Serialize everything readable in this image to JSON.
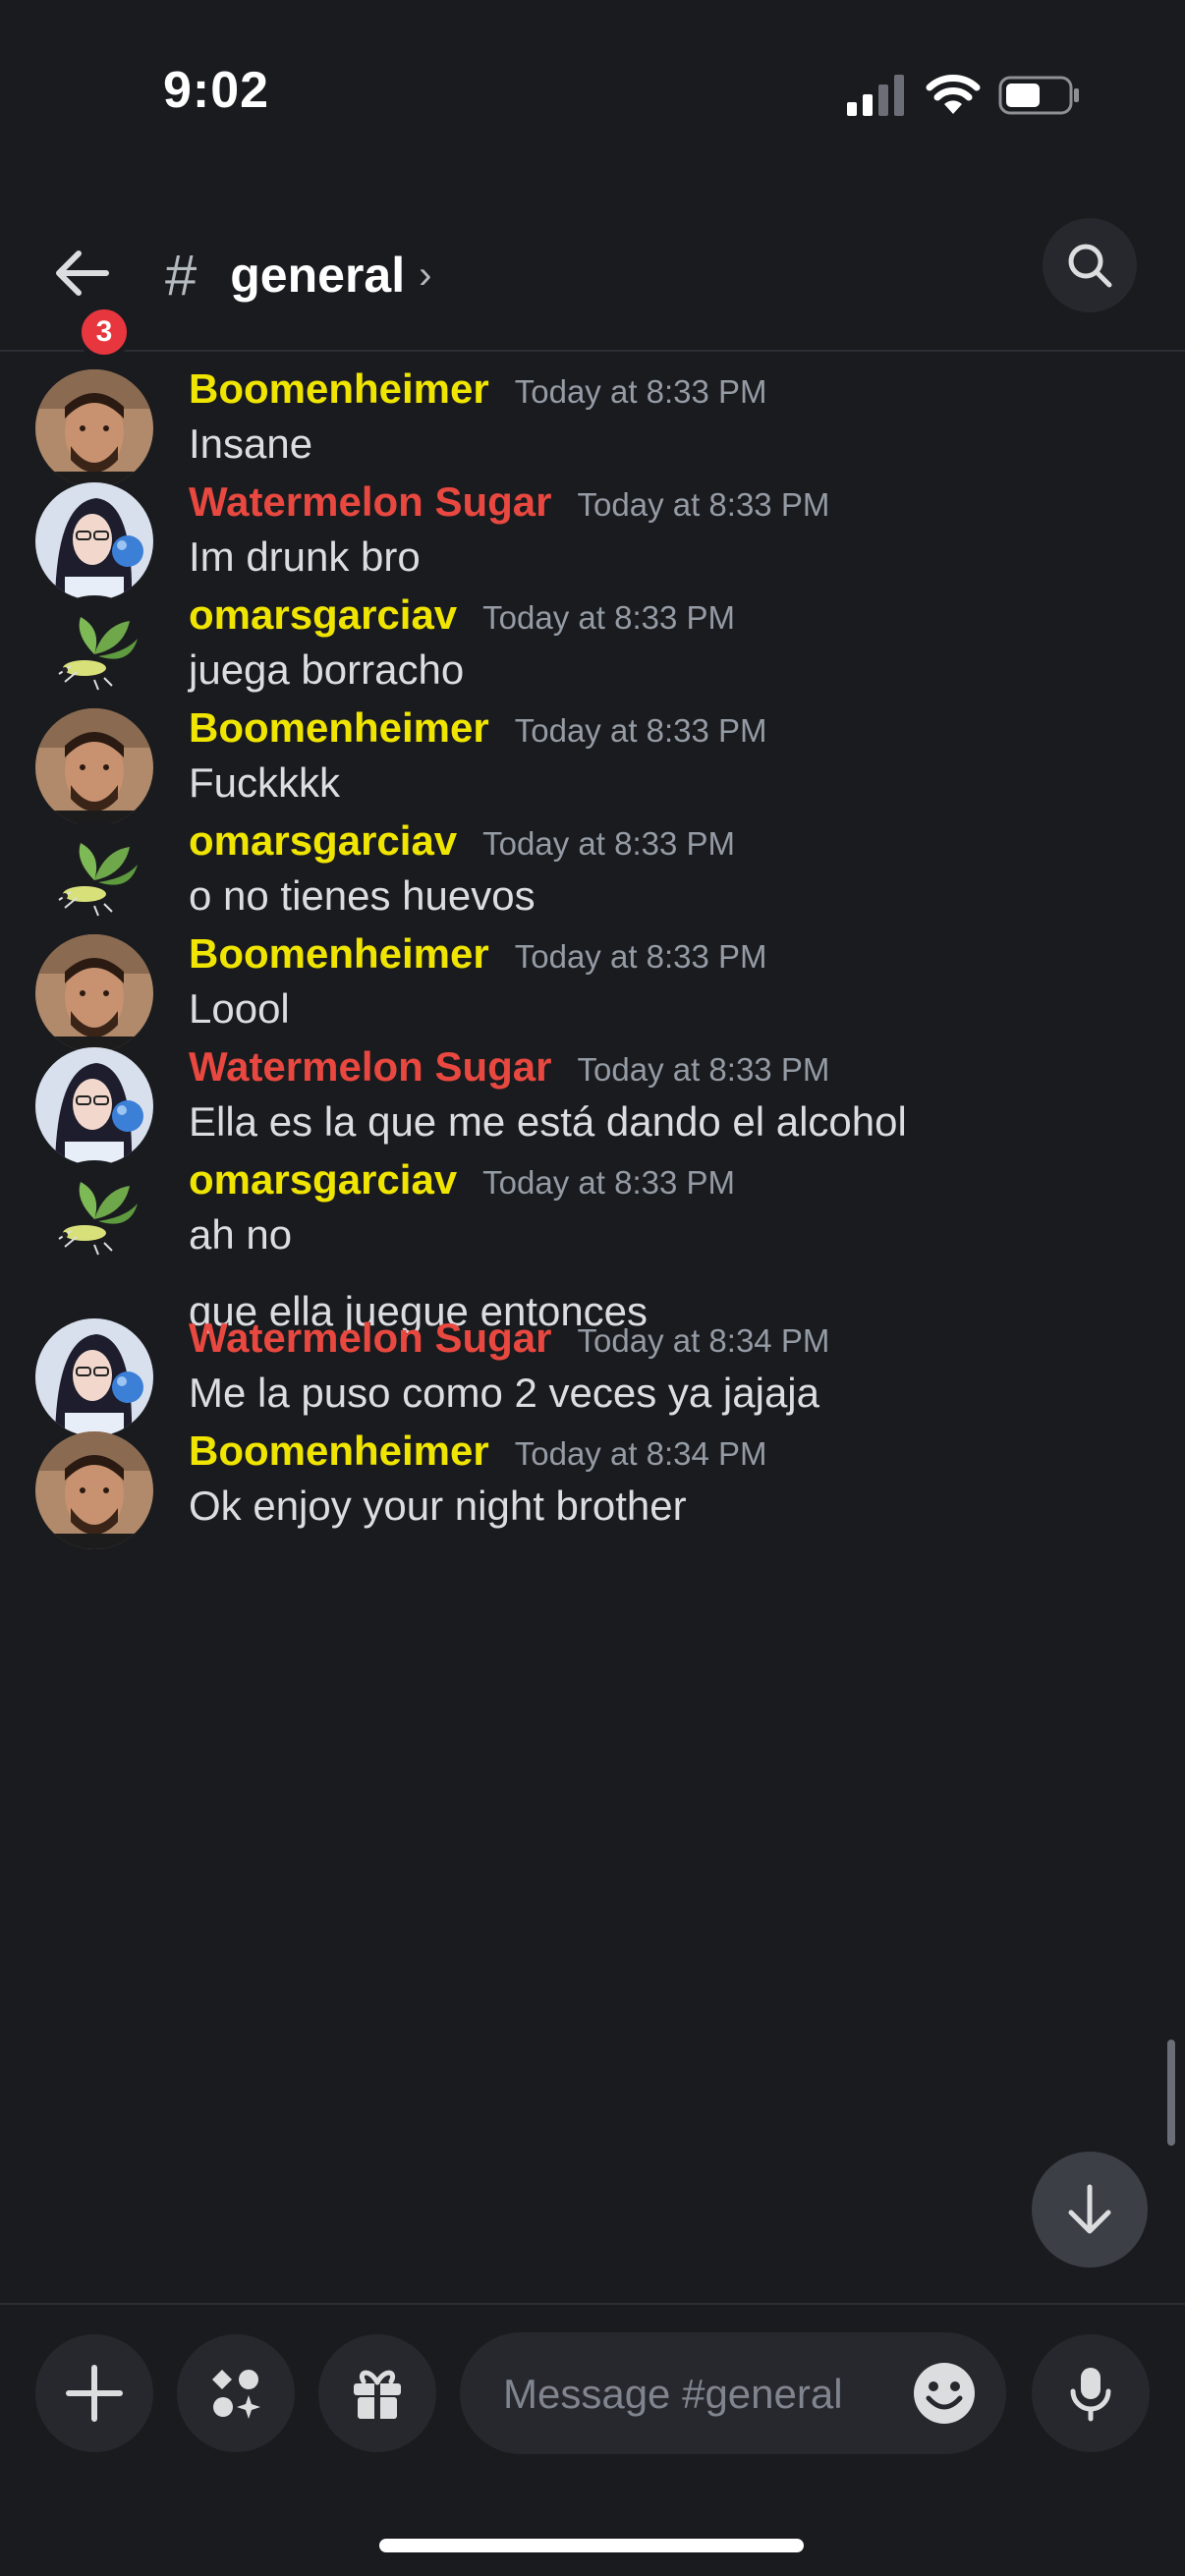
{
  "status_bar": {
    "time": "9:02",
    "signal_icon": "cellular-signal-icon",
    "wifi_icon": "wifi-icon",
    "battery_icon": "battery-icon"
  },
  "header": {
    "back_icon": "arrow-left-icon",
    "unread_count": "3",
    "hash_symbol": "#",
    "channel_name": "general",
    "chevron": "›",
    "search_icon": "search-icon"
  },
  "colors": {
    "background": "#1a1b1f",
    "boomenheimer": "#f0e500",
    "watermelon_sugar": "#e8483f",
    "omarsgarciav": "#f0e500",
    "badge": "#e8363e"
  },
  "messages": [
    {
      "user": "Boomenheimer",
      "time": "Today at 8:33 PM",
      "lines": [
        "Insane"
      ]
    },
    {
      "user": "Watermelon Sugar",
      "time": "Today at 8:33 PM",
      "lines": [
        "Im drunk bro"
      ]
    },
    {
      "user": "omarsgarciav",
      "time": "Today at 8:33 PM",
      "lines": [
        "juega borracho"
      ]
    },
    {
      "user": "Boomenheimer",
      "time": "Today at 8:33 PM",
      "lines": [
        "Fuckkkk"
      ]
    },
    {
      "user": "omarsgarciav",
      "time": "Today at 8:33 PM",
      "lines": [
        "o no tienes huevos"
      ]
    },
    {
      "user": "Boomenheimer",
      "time": "Today at 8:33 PM",
      "lines": [
        "Loool"
      ]
    },
    {
      "user": "Watermelon Sugar",
      "time": "Today at 8:33 PM",
      "lines": [
        "Ella es la que me está dando el alcohol"
      ]
    },
    {
      "user": "omarsgarciav",
      "time": "Today at 8:33 PM",
      "lines": [
        "ah no",
        "que ella juegue entonces"
      ]
    },
    {
      "user": "Watermelon Sugar",
      "time": "Today at 8:34 PM",
      "lines": [
        "Me la puso como 2 veces ya jajaja"
      ]
    },
    {
      "user": "Boomenheimer",
      "time": "Today at 8:34 PM",
      "lines": [
        "Ok enjoy your night brother"
      ]
    }
  ],
  "composer": {
    "add_icon": "plus-icon",
    "apps_icon": "apps-icon",
    "gift_icon": "gift-icon",
    "input_placeholder": "Message #general",
    "emoji_icon": "emoji-icon",
    "mic_icon": "microphone-icon"
  },
  "jump_icon": "arrow-down-icon"
}
